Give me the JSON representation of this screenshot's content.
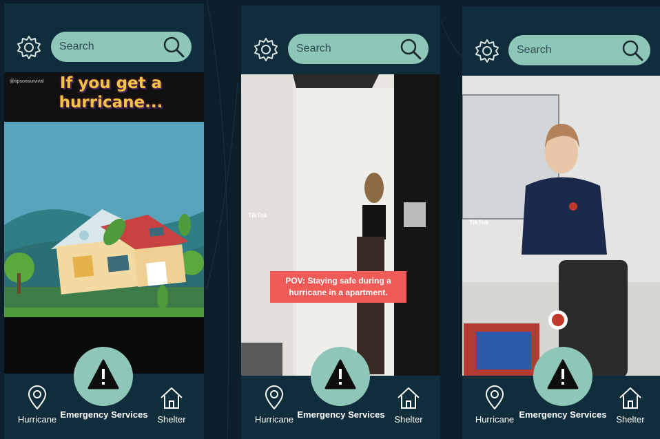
{
  "screens": [
    {
      "search": {
        "placeholder": "Search"
      },
      "video": {
        "caption": "If you get a hurricane...",
        "handle": "@tipsonsurvival"
      },
      "nav": {
        "left": "Hurricane",
        "center": "Emergency Services",
        "right": "Shelter"
      }
    },
    {
      "search": {
        "placeholder": "Search"
      },
      "video": {
        "caption": "POV: Staying safe during a hurricane in a apartment.",
        "watermark": "TikTok"
      },
      "nav": {
        "left": "Hurricane",
        "center": "Emergency Services",
        "right": "Shelter"
      }
    },
    {
      "search": {
        "placeholder": "Search"
      },
      "video": {
        "watermark": "TikTok"
      },
      "nav": {
        "left": "Hurricane",
        "center": "Emergency Services",
        "right": "Shelter"
      }
    }
  ],
  "icons": {
    "settings": "gear-icon",
    "search": "search-icon",
    "hurricane": "map-pin-icon",
    "emergency": "warning-icon",
    "shelter": "home-icon"
  },
  "colors": {
    "background": "#0d1f2b",
    "panel": "#0f2d3a",
    "accent": "#8ec7b8",
    "caption_red": "#f05b57"
  }
}
